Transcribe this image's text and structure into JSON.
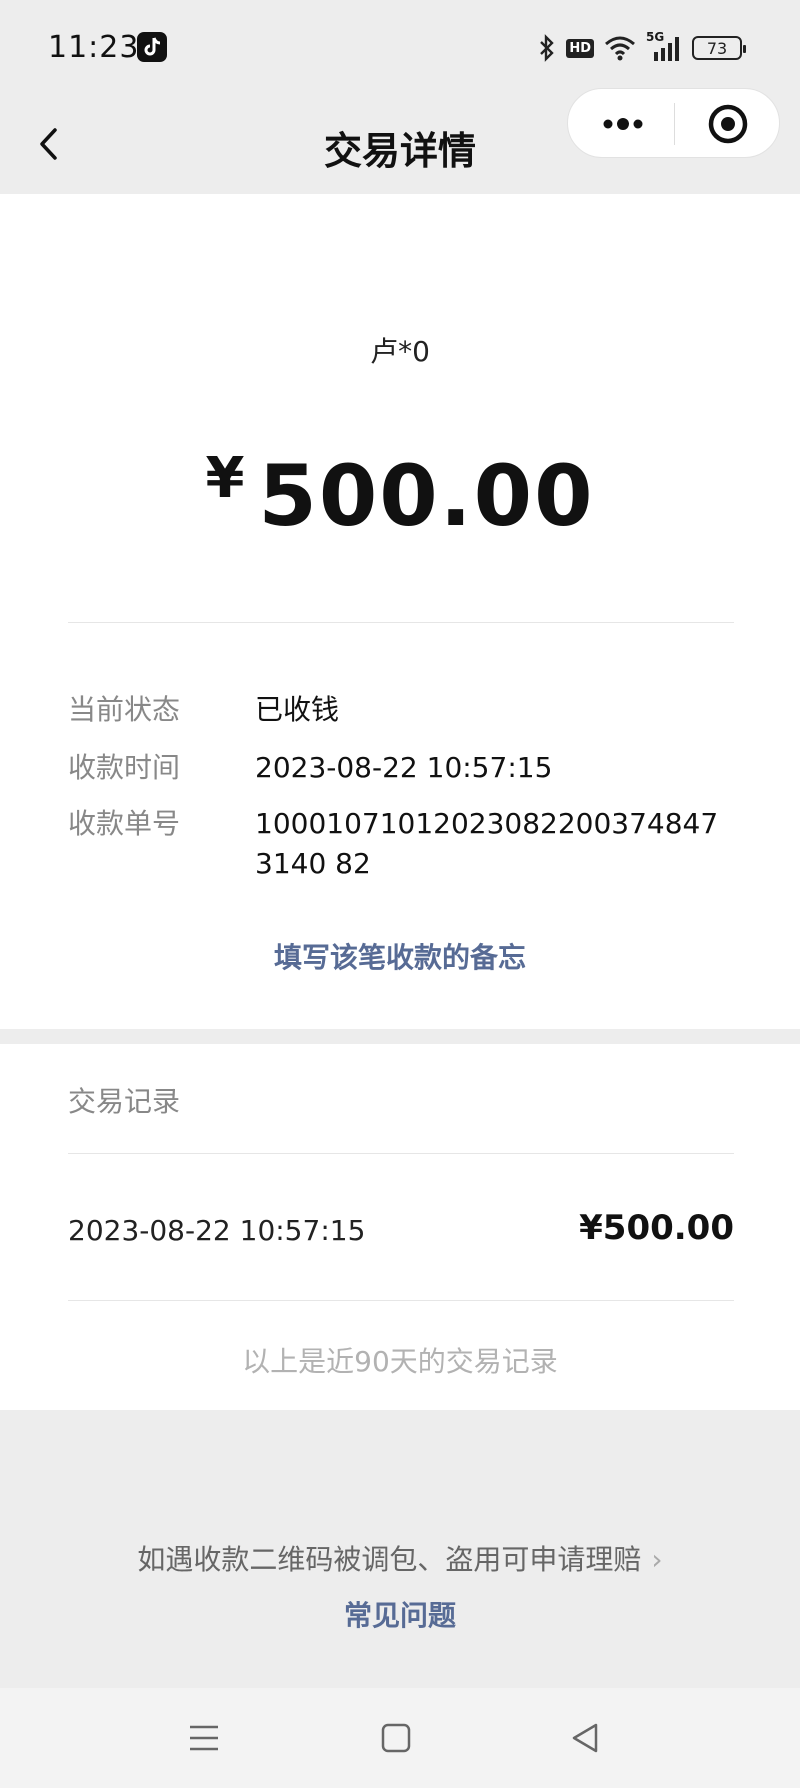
{
  "status_bar": {
    "time": "11:23",
    "battery": "73",
    "network": "5G",
    "hd": "HD"
  },
  "nav": {
    "title": "交易详情"
  },
  "transaction": {
    "payer": "卢*0",
    "currency_symbol": "¥",
    "amount": "500.00",
    "details": [
      {
        "label": "当前状态",
        "value": "已收钱"
      },
      {
        "label": "收款时间",
        "value": "2023-08-22 10:57:15"
      },
      {
        "label": "收款单号",
        "value": "100010710120230822003748473140 82"
      }
    ],
    "memo_link": "填写该笔收款的备忘"
  },
  "records": {
    "title": "交易记录",
    "items": [
      {
        "time": "2023-08-22 10:57:15",
        "amount": "¥500.00"
      }
    ],
    "footnote": "以上是近90天的交易记录"
  },
  "footer": {
    "claim_text": "如遇收款二维码被调包、盗用可申请理赔",
    "claim_chevron": "›",
    "faq_link": "常见问题"
  },
  "icons": {
    "back": "chevron-left-icon",
    "more": "more-dots-icon",
    "close_miniprogram": "target-icon",
    "menu": "menu-icon",
    "home": "home-square-icon",
    "back_triangle": "back-triangle-icon"
  },
  "colors": {
    "link": "#576b95",
    "background": "#ededed",
    "card": "#ffffff"
  }
}
